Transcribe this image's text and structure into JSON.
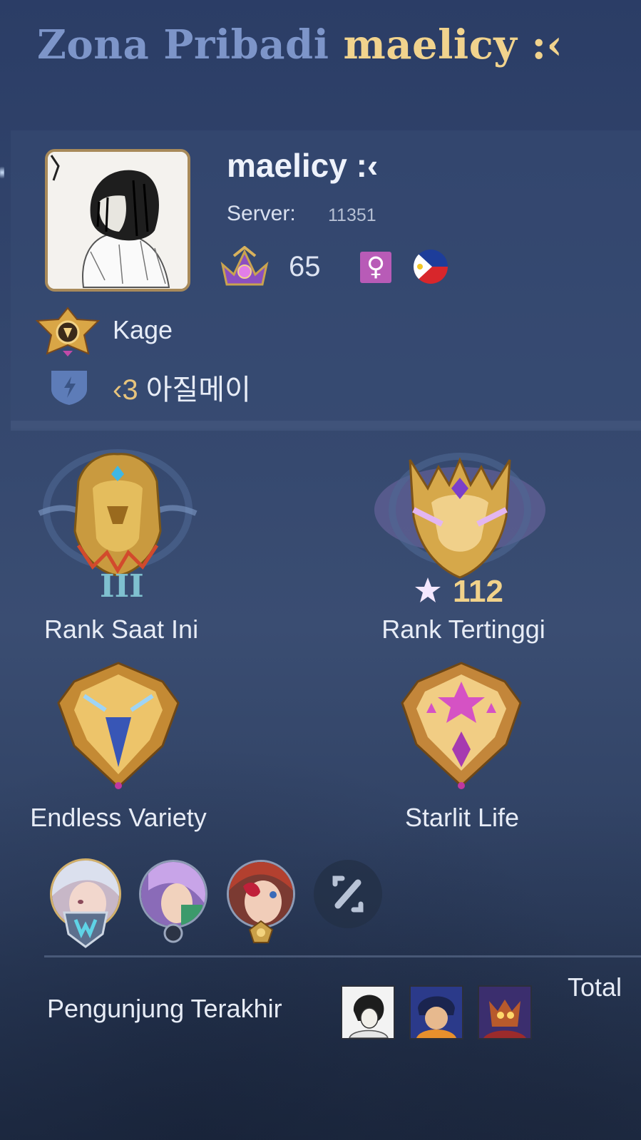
{
  "header": {
    "title_prefix": "Zona Pribadi",
    "title_name": "maelicy :‹"
  },
  "profile": {
    "username": "maelicy :‹",
    "server_label": "Server:",
    "server_id": "11351",
    "level": "65",
    "gender_symbol": "♀",
    "country_flag": "philippines-flag",
    "title_badge": "Kage",
    "squad_prefix": "‹3",
    "squad_name": "아질메이"
  },
  "ranks": {
    "current": {
      "label": "Rank Saat Ini",
      "tier": "III"
    },
    "highest": {
      "label": "Rank Tertinggi",
      "stars": "112"
    }
  },
  "achievements": [
    {
      "label": "Endless Variety"
    },
    {
      "label": "Starlit Life"
    }
  ],
  "favorite_heroes": [
    "hero-1",
    "hero-2",
    "hero-3"
  ],
  "visitors": {
    "label": "Pengunjung Terakhir",
    "total_label": "Total"
  },
  "colors": {
    "accent_gold": "#f1d38d",
    "title_blue": "#7d95c9",
    "gender": "#b85bb7"
  }
}
